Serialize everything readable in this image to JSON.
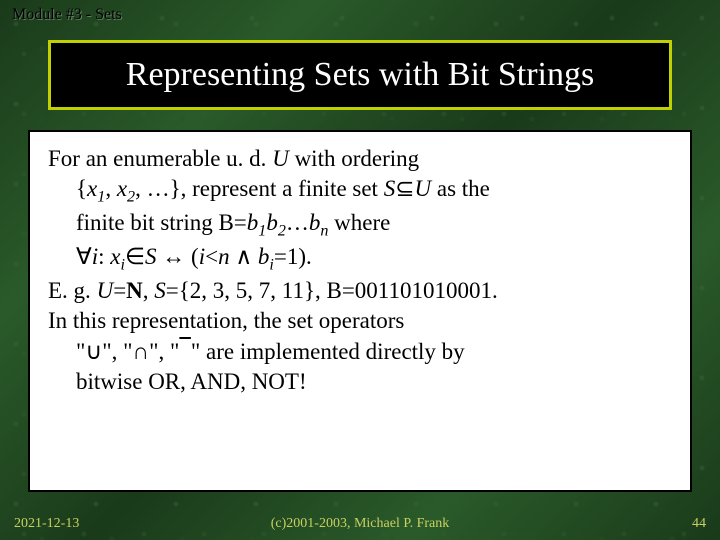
{
  "module_header": "Module #3 - Sets",
  "title": "Representing Sets with Bit Strings",
  "body": {
    "p1_a": "For an enumerable u. d. ",
    "p1_U": "U",
    "p1_b": " with ordering",
    "p2_a": "{",
    "p2_x1": "x",
    "p2_sub1": "1",
    "p2_comma1": ", ",
    "p2_x2": "x",
    "p2_sub2": "2",
    "p2_b": ", …}, represent a finite set ",
    "p2_S": "S",
    "p2_subset": "⊆",
    "p2_U": "U",
    "p2_c": " as the",
    "p3_a": "finite bit string B=",
    "p3_b1": "b",
    "p3_s1": "1",
    "p3_b2": "b",
    "p3_s2": "2",
    "p3_dots": "…",
    "p3_bn": "b",
    "p3_sn": "n",
    "p3_c": " where",
    "p4_forall": "∀",
    "p4_i": "i",
    "p4_colon": ": ",
    "p4_xi": "x",
    "p4_si": "i",
    "p4_in": "∈",
    "p4_S": "S",
    "p4_iff": " ↔ (",
    "p4_i2": "i",
    "p4_lt": "<",
    "p4_n": "n",
    "p4_and": " ∧ ",
    "p4_bi": "b",
    "p4_sbi": "i",
    "p4_eq1": "=1).",
    "p5_a": "E. g. ",
    "p5_U": "U",
    "p5_b": "=",
    "p5_N": "N",
    "p5_c": ", ",
    "p5_S": "S",
    "p5_d": "={2, 3, 5, 7, 11}, B=001101010001.",
    "p6": "In this representation, the set operators",
    "p7_a": "\"∪\", \"∩\", \"",
    "p7_b": "\" are implemented directly by",
    "p8": "bitwise OR, AND, NOT!"
  },
  "footer": {
    "date": "2021-12-13",
    "copyright": "(c)2001-2003, Michael P. Frank",
    "page": "44"
  }
}
